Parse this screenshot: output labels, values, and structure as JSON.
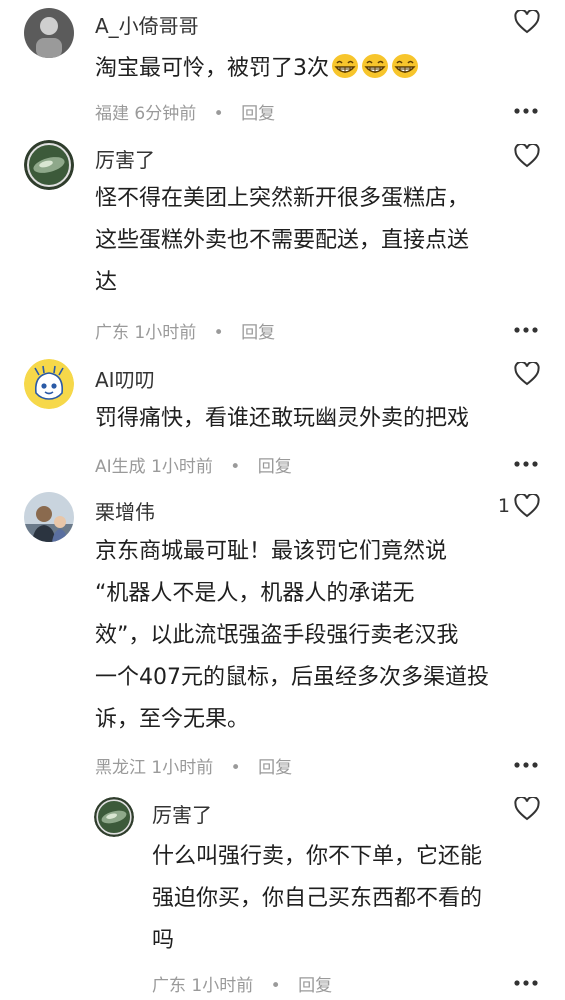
{
  "comments": [
    {
      "user": "A_小倚哥哥",
      "text": "淘宝最可怜，被罚了3次",
      "emojis": [
        "grin-emoji",
        "grin-emoji",
        "grin-emoji"
      ],
      "location": "福建",
      "time": "6分钟前",
      "reply": "回复"
    },
    {
      "user": "厉害了",
      "line1": "怪不得在美团上突然新开很多蛋糕店，",
      "line2": "这些蛋糕外卖也不需要配送，直接点送",
      "line3": "达",
      "location": "广东",
      "time": "1小时前",
      "reply": "回复"
    },
    {
      "user": "AI叨叨",
      "text": "罚得痛快，看谁还敢玩幽灵外卖的把戏",
      "location": "AI生成",
      "time": "1小时前",
      "reply": "回复"
    },
    {
      "user": "栗增伟",
      "likes": "1",
      "line1": "京东商城最可耻！最该罚它们竟然说",
      "line2": "“机器人不是人，机器人的承诺无",
      "line3": "效”，以此流氓强盗手段强行卖老汉我",
      "line4": "一个407元的鼠标，后虽经多次多渠道投",
      "line5": "诉，至今无果。",
      "location": "黑龙江",
      "time": "1小时前",
      "reply": "回复"
    }
  ],
  "sub_reply": {
    "user": "厉害了",
    "line1": "什么叫强行卖，你不下单，它还能",
    "line2": "强迫你买，你自己买东西都不看的",
    "line3": "吗",
    "location": "广东",
    "time": "1小时前",
    "reply": "回复"
  },
  "colors": {
    "meta": "#9a9a9a",
    "text": "#1f1f1f",
    "emoji": "#f7c52c"
  }
}
